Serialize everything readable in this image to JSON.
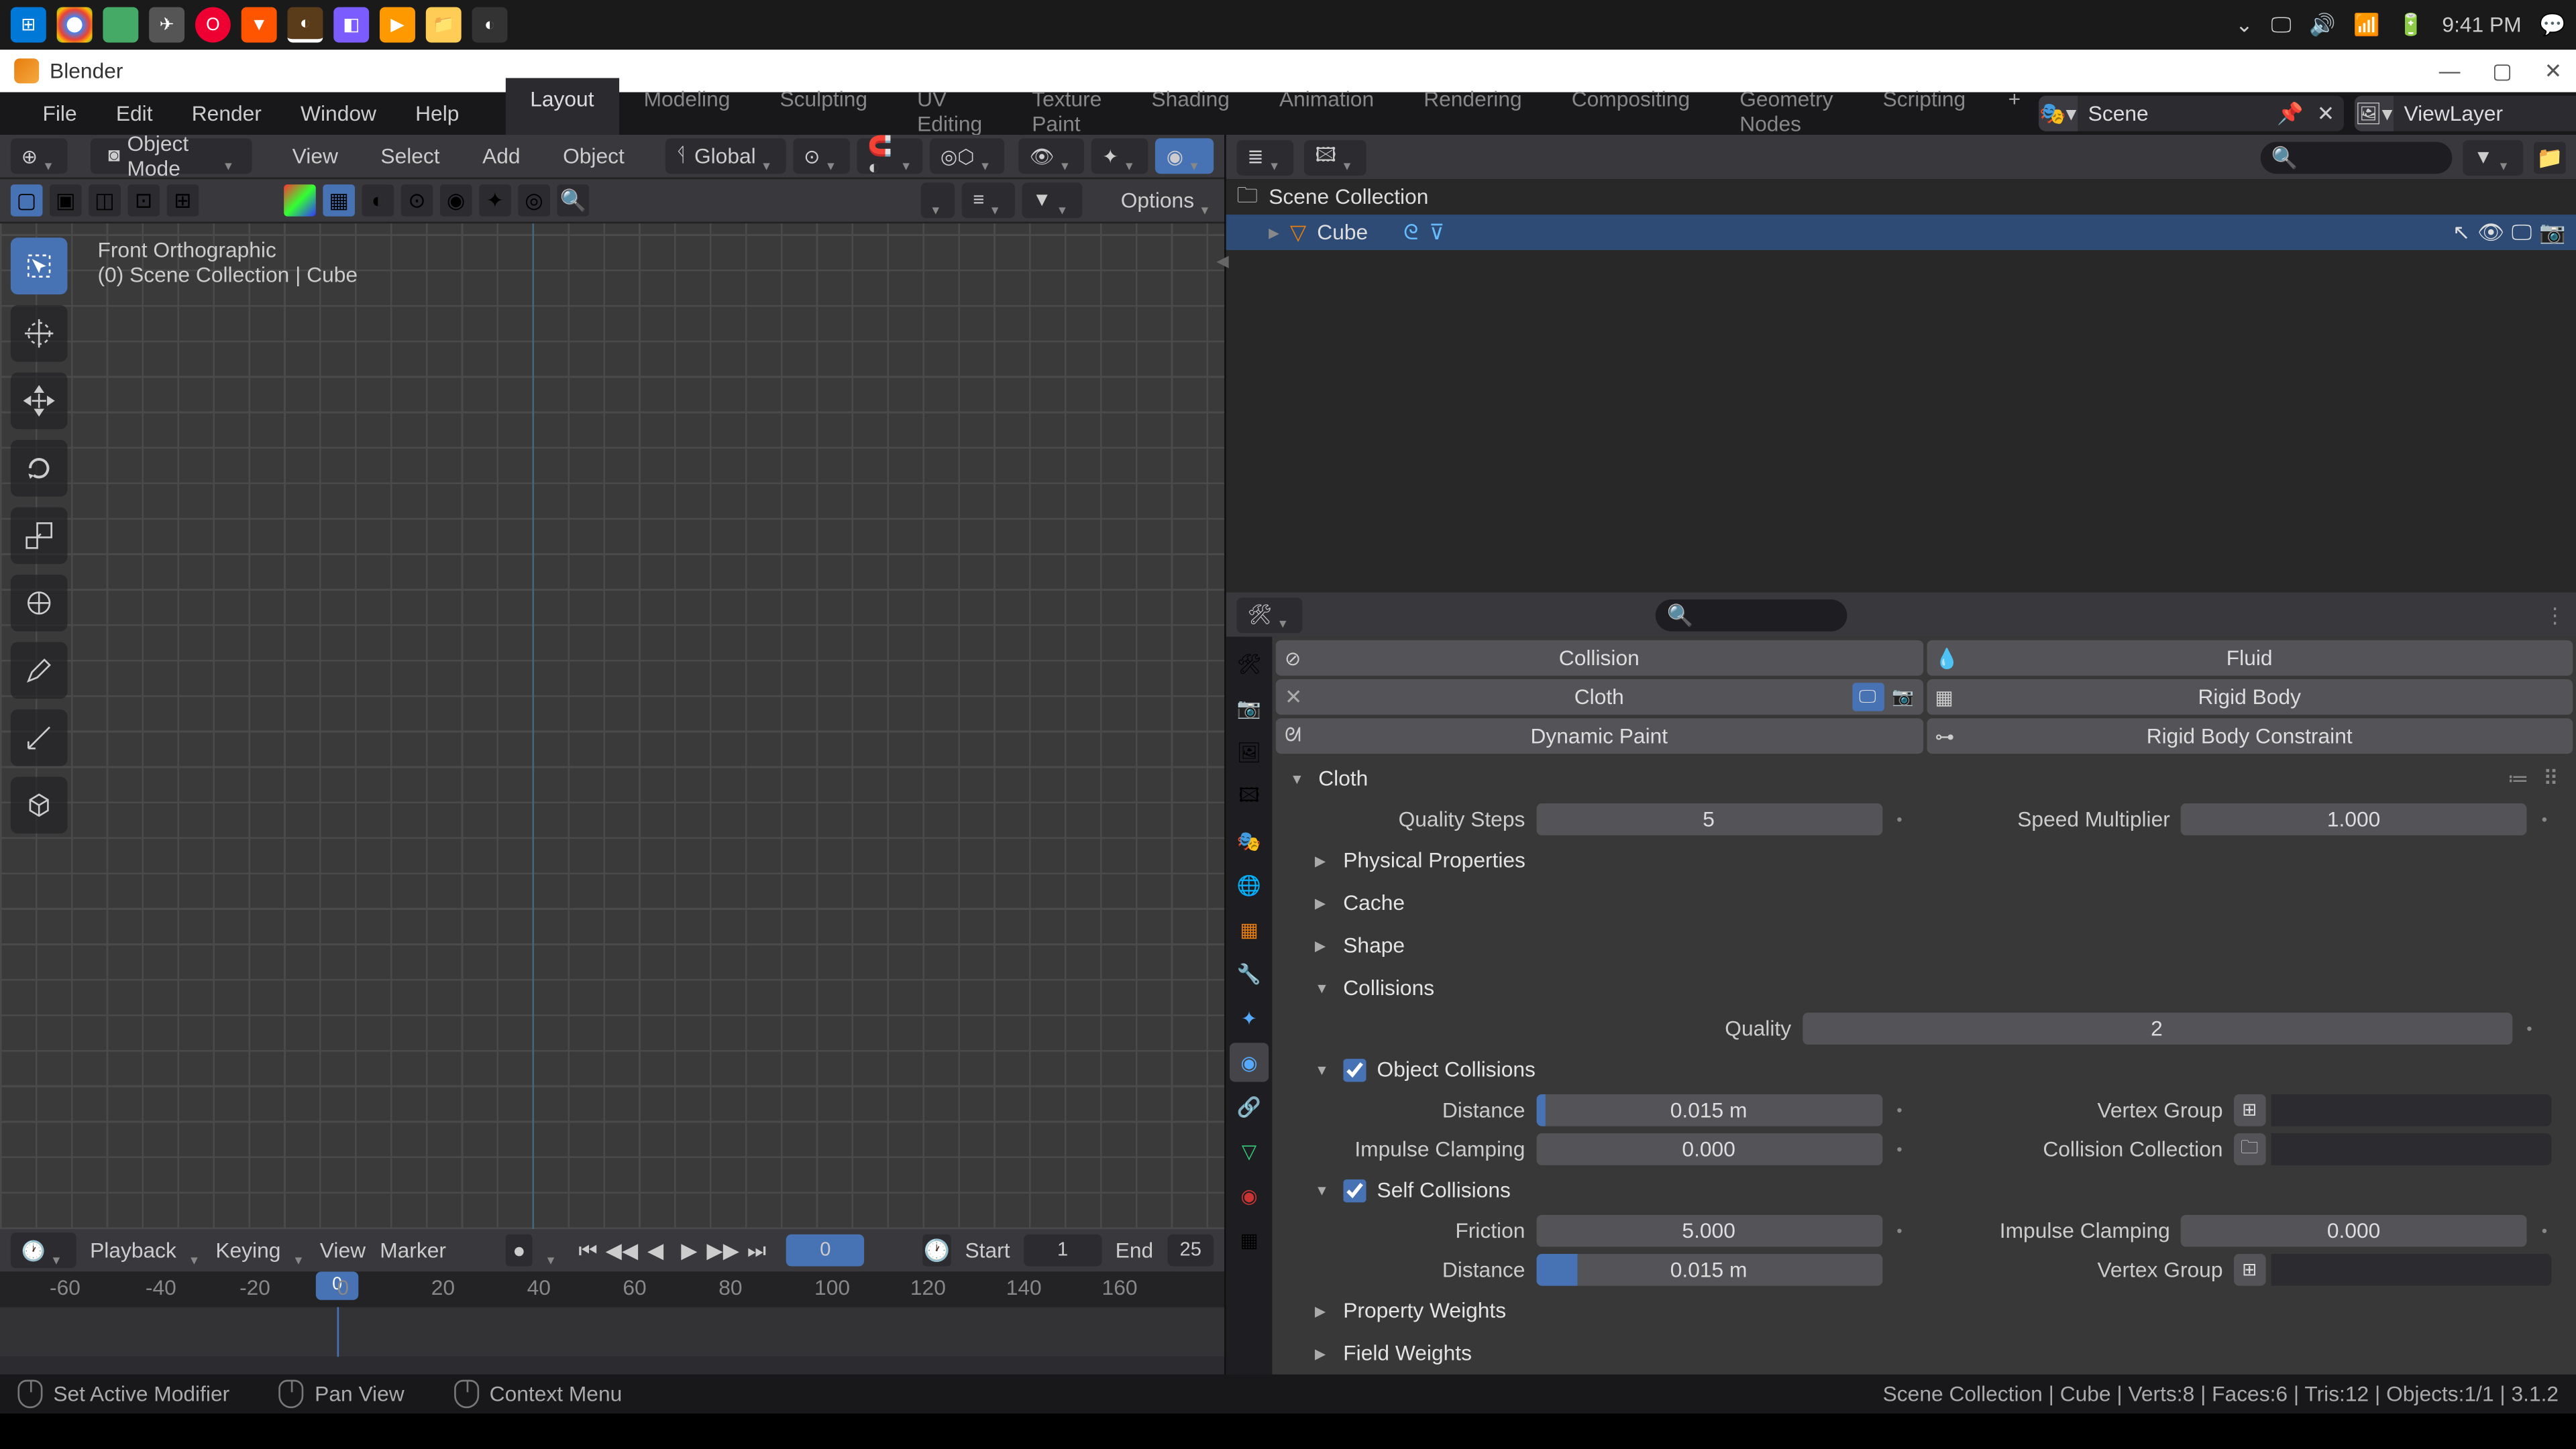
{
  "os": {
    "clock": "9:41 PM"
  },
  "window": {
    "title": "Blender"
  },
  "menus": [
    "File",
    "Edit",
    "Render",
    "Window",
    "Help"
  ],
  "workspace_tabs": [
    "Layout",
    "Modeling",
    "Sculpting",
    "UV Editing",
    "Texture Paint",
    "Shading",
    "Animation",
    "Rendering",
    "Compositing",
    "Geometry Nodes",
    "Scripting"
  ],
  "active_tab": "Layout",
  "scene_name": "Scene",
  "view_layer": "ViewLayer",
  "mode": "Object Mode",
  "viewport_menus": [
    "View",
    "Select",
    "Add",
    "Object"
  ],
  "orientation": "Global",
  "viewport_options_label": "Options",
  "viewport": {
    "orientation_label": "Front Orthographic",
    "path": "(0) Scene Collection | Cube"
  },
  "timeline": {
    "menus": [
      "Playback",
      "Keying",
      "View",
      "Marker"
    ],
    "current": "0",
    "start_label": "Start",
    "start": "1",
    "end_label": "End",
    "end": "25",
    "ticks": [
      {
        "label": "-60",
        "pos": 28
      },
      {
        "label": "-40",
        "pos": 82
      },
      {
        "label": "-20",
        "pos": 135
      },
      {
        "label": "0",
        "pos": 190
      },
      {
        "label": "20",
        "pos": 243
      },
      {
        "label": "40",
        "pos": 297
      },
      {
        "label": "60",
        "pos": 351
      },
      {
        "label": "80",
        "pos": 405
      },
      {
        "label": "100",
        "pos": 459
      },
      {
        "label": "120",
        "pos": 513
      },
      {
        "label": "140",
        "pos": 567
      },
      {
        "label": "160",
        "pos": 621
      }
    ]
  },
  "outliner": {
    "root": "Scene Collection",
    "item": "Cube"
  },
  "physics": {
    "buttons": [
      {
        "label": "Collision",
        "lead": "⊘"
      },
      {
        "label": "Fluid",
        "lead": "💧"
      },
      {
        "label": "Cloth",
        "close": true,
        "icons": true
      },
      {
        "label": "Rigid Body",
        "lead": "▦"
      },
      {
        "label": "Dynamic Paint",
        "lead": "ᘛ"
      },
      {
        "label": "Rigid Body Constraint",
        "lead": "⊶"
      }
    ],
    "cloth_header": "Cloth",
    "quality_steps_label": "Quality Steps",
    "quality_steps": "5",
    "speed_mult_label": "Speed Multiplier",
    "speed_mult": "1.000",
    "sub_phys": "Physical Properties",
    "sub_cache": "Cache",
    "sub_shape": "Shape",
    "collisions_header": "Collisions",
    "quality_label": "Quality",
    "quality": "2",
    "obj_coll_header": "Object Collisions",
    "distance_label": "Distance",
    "distance": "0.015 m",
    "impulse_label": "Impulse Clamping",
    "impulse": "0.000",
    "vgroup_label": "Vertex Group",
    "coll_collection_label": "Collision Collection",
    "self_coll_header": "Self Collisions",
    "friction_label": "Friction",
    "friction": "5.000",
    "self_distance": "0.015 m",
    "self_impulse_label": "Impulse Clamping",
    "self_impulse": "0.000",
    "prop_weights": "Property Weights",
    "field_weights": "Field Weights"
  },
  "statusbar": {
    "left1": "Set Active Modifier",
    "left2": "Pan View",
    "left3": "Context Menu",
    "right": "Scene Collection | Cube | Verts:8 | Faces:6 | Tris:12 | Objects:1/1 | 3.1.2"
  }
}
